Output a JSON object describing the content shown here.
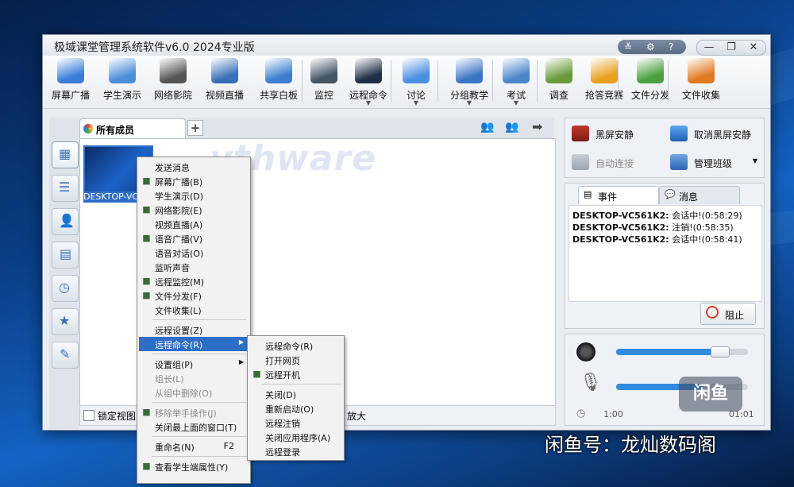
{
  "window": {
    "title": "极域课堂管理系统软件v6.0 2024专业版",
    "title_buttons": [
      "chevron-double-down-icon",
      "gear-icon",
      "help-icon"
    ],
    "window_buttons": [
      "minimize",
      "restore",
      "close"
    ]
  },
  "toolbar": {
    "items": [
      {
        "label": "屏幕广播",
        "icon": "screen-broadcast-icon",
        "color": "#3a7dd8",
        "dropdown": false
      },
      {
        "label": "学生演示",
        "icon": "student-demo-icon",
        "color": "#4a8fd8",
        "dropdown": false
      },
      {
        "label": "网络影院",
        "icon": "film-reel-icon",
        "color": "#555555",
        "dropdown": false
      },
      {
        "label": "视频直播",
        "icon": "webcam-icon",
        "color": "#3a6fb8",
        "dropdown": false
      },
      {
        "label": "共享白板",
        "icon": "whiteboard-icon",
        "color": "#3c7ed0",
        "dropdown": false
      },
      {
        "label": "监控",
        "icon": "monitor-person-icon",
        "color": "#445566",
        "dropdown": false
      },
      {
        "label": "远程命令",
        "icon": "command-prompt-icon",
        "color": "#1f2f45",
        "dropdown": true
      },
      {
        "label": "讨论",
        "icon": "chat-bubbles-icon",
        "color": "#4a90e0",
        "dropdown": true
      },
      {
        "label": "分组教学",
        "icon": "group-people-icon",
        "color": "#3b76c4",
        "dropdown": true
      },
      {
        "label": "考试",
        "icon": "exam-clock-icon",
        "color": "#4b86c8",
        "dropdown": true
      },
      {
        "label": "调查",
        "icon": "survey-bars-icon",
        "color": "#6a9a3a",
        "dropdown": false
      },
      {
        "label": "抢答竞赛",
        "icon": "quiz-star-icon",
        "color": "#e8a020",
        "dropdown": false
      },
      {
        "label": "文件分发",
        "icon": "file-send-icon",
        "color": "#4aa040",
        "dropdown": false
      },
      {
        "label": "文件收集",
        "icon": "file-collect-icon",
        "color": "#e07a20",
        "dropdown": false
      }
    ]
  },
  "members": {
    "tab_label": "所有成员",
    "add_tab": "+",
    "student_label": "DESKTOP-VC",
    "watermark": "ythware"
  },
  "statusbar": {
    "lock_label": "锁定视图",
    "zoom_label": "放大"
  },
  "right_panel": {
    "black_screen": "黑屏安静",
    "cancel_black_screen": "取消黑屏安静",
    "auto_connect": "自动连接",
    "manage_class": "管理班级",
    "tab_events": "事件",
    "tab_messages": "消息",
    "events": [
      {
        "host": "DESKTOP-VC561K2:",
        "text": "会话中!(0:58:29)"
      },
      {
        "host": "DESKTOP-VC561K2:",
        "text": "注销!(0:58:35)"
      },
      {
        "host": "DESKTOP-VC561K2:",
        "text": "会话中!(0:58:41)"
      }
    ],
    "block_button": "阻止",
    "speaker_level": 0.74,
    "mic_level": 0.66,
    "elapsed": "1:00",
    "total": "01:01"
  },
  "context_menu": {
    "items": [
      {
        "label": "发送消息",
        "icon": "",
        "shortcut": "",
        "sub": false,
        "disabled": false,
        "sep_before": false
      },
      {
        "label": "屏幕广播(B)",
        "icon": "screen-broadcast-icon",
        "shortcut": "",
        "sub": false,
        "disabled": false,
        "sep_before": false
      },
      {
        "label": "学生演示(D)",
        "icon": "",
        "shortcut": "",
        "sub": false,
        "disabled": false,
        "sep_before": false
      },
      {
        "label": "网络影院(E)",
        "icon": "film-reel-icon",
        "shortcut": "",
        "sub": false,
        "disabled": false,
        "sep_before": false
      },
      {
        "label": "视频直播(A)",
        "icon": "",
        "shortcut": "",
        "sub": false,
        "disabled": false,
        "sep_before": false
      },
      {
        "label": "语音广播(V)",
        "icon": "microphone-icon",
        "shortcut": "",
        "sub": false,
        "disabled": false,
        "sep_before": false
      },
      {
        "label": "语音对话(O)",
        "icon": "",
        "shortcut": "",
        "sub": false,
        "disabled": false,
        "sep_before": false
      },
      {
        "label": "监听声音",
        "icon": "",
        "shortcut": "",
        "sub": false,
        "disabled": false,
        "sep_before": false
      },
      {
        "label": "远程监控(M)",
        "icon": "remote-monitor-icon",
        "shortcut": "",
        "sub": false,
        "disabled": false,
        "sep_before": false
      },
      {
        "label": "文件分发(F)",
        "icon": "file-send-icon",
        "shortcut": "",
        "sub": false,
        "disabled": false,
        "sep_before": false
      },
      {
        "label": "文件收集(L)",
        "icon": "",
        "shortcut": "",
        "sub": false,
        "disabled": false,
        "sep_before": false
      },
      {
        "label": "远程设置(Z)",
        "icon": "",
        "shortcut": "",
        "sub": false,
        "disabled": false,
        "sep_before": true
      },
      {
        "label": "远程命令(R)",
        "icon": "",
        "shortcut": "",
        "sub": true,
        "disabled": false,
        "sep_before": false,
        "highlight": true
      },
      {
        "label": "设置组(P)",
        "icon": "",
        "shortcut": "",
        "sub": true,
        "disabled": false,
        "sep_before": true
      },
      {
        "label": "组长(L)",
        "icon": "",
        "shortcut": "",
        "sub": false,
        "disabled": true,
        "sep_before": false
      },
      {
        "label": "从组中删除(O)",
        "icon": "",
        "shortcut": "",
        "sub": false,
        "disabled": true,
        "sep_before": false
      },
      {
        "label": "移除举手操作(J)",
        "icon": "hand-off-icon",
        "shortcut": "",
        "sub": false,
        "disabled": true,
        "sep_before": true
      },
      {
        "label": "关闭最上面的窗口(T)",
        "icon": "",
        "shortcut": "",
        "sub": false,
        "disabled": false,
        "sep_before": false
      },
      {
        "label": "重命名(N)",
        "icon": "",
        "shortcut": "F2",
        "sub": false,
        "disabled": false,
        "sep_before": true
      },
      {
        "label": "查看学生端属性(Y)",
        "icon": "properties-icon",
        "shortcut": "",
        "sub": false,
        "disabled": false,
        "sep_before": true
      }
    ]
  },
  "submenu": {
    "items": [
      {
        "label": "远程命令(R)",
        "icon": "",
        "sep_before": false
      },
      {
        "label": "打开网页",
        "icon": "",
        "sep_before": false
      },
      {
        "label": "远程开机",
        "icon": "power-arrow-icon",
        "sep_before": false
      },
      {
        "label": "关闭(D)",
        "icon": "",
        "sep_before": true
      },
      {
        "label": "重新启动(O)",
        "icon": "",
        "sep_before": false
      },
      {
        "label": "远程注销",
        "icon": "",
        "sep_before": false
      },
      {
        "label": "关闭应用程序(A)",
        "icon": "",
        "sep_before": false
      },
      {
        "label": "远程登录",
        "icon": "",
        "sep_before": false
      }
    ]
  },
  "overlay": {
    "badge": "闲鱼",
    "caption": "闲鱼号：龙灿数码阁"
  }
}
